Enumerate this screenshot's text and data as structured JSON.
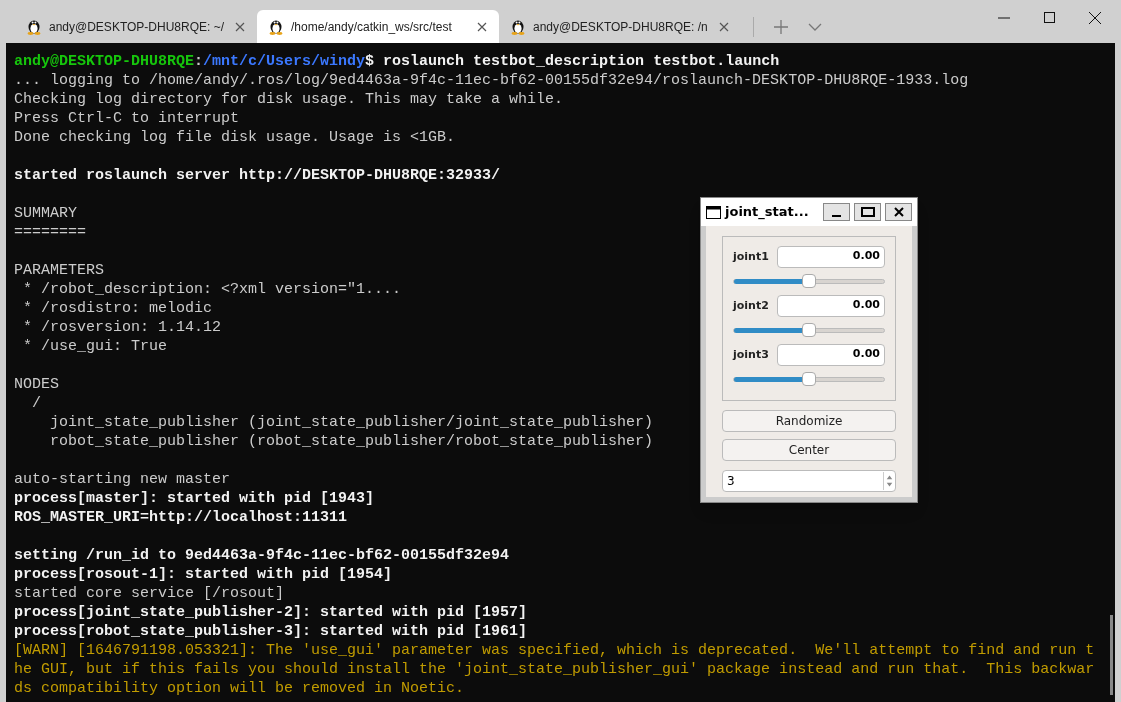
{
  "tabs": [
    {
      "title": "andy@DESKTOP-DHU8RQE: ~/",
      "selected": false
    },
    {
      "title": "/home/andy/catkin_ws/src/test",
      "selected": true
    },
    {
      "title": "andy@DESKTOP-DHU8RQE: /n",
      "selected": false
    }
  ],
  "terminal": {
    "lines": [
      {
        "kind": "prompt",
        "user": "andy@DESKTOP-DHU8RQE",
        "sep": ":",
        "path": "/mnt/c/Users/windy",
        "command": "$ roslaunch testbot_description testbot.launch"
      },
      {
        "kind": "normal",
        "text": "... logging to /home/andy/.ros/log/9ed4463a-9f4c-11ec-bf62-00155df32e94/roslaunch-DESKTOP-DHU8RQE-1933.log"
      },
      {
        "kind": "normal",
        "text": "Checking log directory for disk usage. This may take a while."
      },
      {
        "kind": "normal",
        "text": "Press Ctrl-C to interrupt"
      },
      {
        "kind": "normal",
        "text": "Done checking log file disk usage. Usage is <1GB."
      },
      {
        "kind": "blank"
      },
      {
        "kind": "bold",
        "text": "started roslaunch server http://DESKTOP-DHU8RQE:32933/"
      },
      {
        "kind": "blank"
      },
      {
        "kind": "normal",
        "text": "SUMMARY"
      },
      {
        "kind": "normal",
        "text": "========"
      },
      {
        "kind": "blank"
      },
      {
        "kind": "normal",
        "text": "PARAMETERS"
      },
      {
        "kind": "normal",
        "text": " * /robot_description: <?xml version=\"1...."
      },
      {
        "kind": "normal",
        "text": " * /rosdistro: melodic"
      },
      {
        "kind": "normal",
        "text": " * /rosversion: 1.14.12"
      },
      {
        "kind": "normal",
        "text": " * /use_gui: True"
      },
      {
        "kind": "blank"
      },
      {
        "kind": "normal",
        "text": "NODES"
      },
      {
        "kind": "normal",
        "text": "  /"
      },
      {
        "kind": "normal",
        "text": "    joint_state_publisher (joint_state_publisher/joint_state_publisher)"
      },
      {
        "kind": "normal",
        "text": "    robot_state_publisher (robot_state_publisher/robot_state_publisher)"
      },
      {
        "kind": "blank"
      },
      {
        "kind": "normal",
        "text": "auto-starting new master"
      },
      {
        "kind": "bold",
        "text": "process[master]: started with pid [1943]"
      },
      {
        "kind": "bold",
        "text": "ROS_MASTER_URI=http://localhost:11311"
      },
      {
        "kind": "blank"
      },
      {
        "kind": "bold",
        "text": "setting /run_id to 9ed4463a-9f4c-11ec-bf62-00155df32e94"
      },
      {
        "kind": "bold",
        "text": "process[rosout-1]: started with pid [1954]"
      },
      {
        "kind": "normal",
        "text": "started core service [/rosout]"
      },
      {
        "kind": "bold",
        "text": "process[joint_state_publisher-2]: started with pid [1957]"
      },
      {
        "kind": "bold",
        "text": "process[robot_state_publisher-3]: started with pid [1961]"
      },
      {
        "kind": "warn",
        "text": "[WARN] [1646791198.053321]: The 'use_gui' parameter was specified, which is deprecated.  We'll attempt to find and run t"
      },
      {
        "kind": "warn",
        "text": "he GUI, but if this fails you should install the 'joint_state_publisher_gui' package instead and run that.  This backwar"
      },
      {
        "kind": "warn",
        "text": "ds compatibility option will be removed in Noetic."
      }
    ]
  },
  "dialog": {
    "title": "joint_stat...",
    "joints": [
      {
        "name": "joint1",
        "value": "0.00",
        "level": 0.5
      },
      {
        "name": "joint2",
        "value": "0.00",
        "level": 0.5
      },
      {
        "name": "joint3",
        "value": "0.00",
        "level": 0.5
      }
    ],
    "buttons": [
      "Randomize",
      "Center"
    ],
    "spinbox": {
      "value": "3"
    }
  }
}
